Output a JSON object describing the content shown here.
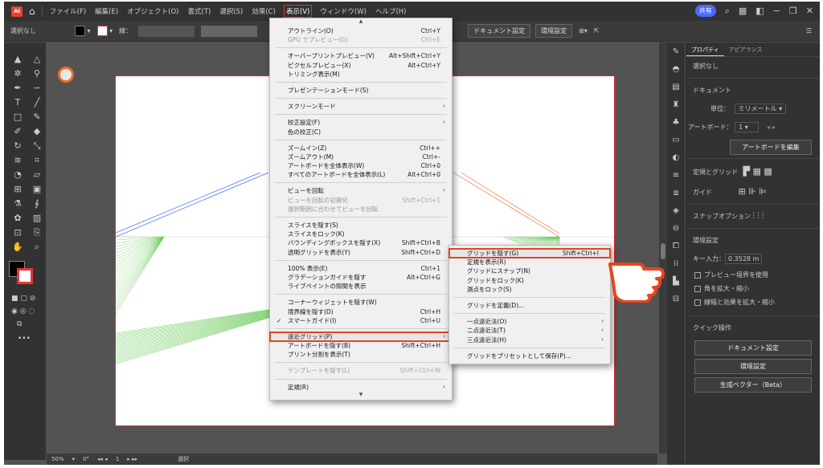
{
  "menubar": {
    "logo": "Ai",
    "items": [
      "ファイル(F)",
      "編集(E)",
      "オブジェクト(O)",
      "書式(T)",
      "選択(S)",
      "効果(C)",
      "表示(V)",
      "ウィンドウ(W)",
      "ヘルプ(H)"
    ],
    "active_index": 6,
    "share": "共有"
  },
  "control": {
    "selection": "選択なし",
    "stroke_label": "線：",
    "doc_settings": "ドキュメント設定",
    "preferences": "環境設定"
  },
  "view_menu": {
    "rows": [
      {
        "label": "アウトライン(O)",
        "shortcut": "Ctrl+Y"
      },
      {
        "label": "GPU でプレビュー(G)",
        "shortcut": "Ctrl+E",
        "disabled": true
      },
      {
        "sep": true
      },
      {
        "label": "オーバープリントプレビュー(V)",
        "shortcut": "Alt+Shift+Ctrl+Y"
      },
      {
        "label": "ピクセルプレビュー(X)",
        "shortcut": "Alt+Ctrl+Y"
      },
      {
        "label": "トリミング表示(M)",
        "shortcut": ""
      },
      {
        "sep": true
      },
      {
        "label": "プレゼンテーションモード(S)",
        "shortcut": ""
      },
      {
        "sep": true
      },
      {
        "label": "スクリーンモード",
        "shortcut": "",
        "sub": true
      },
      {
        "sep": true
      },
      {
        "label": "校正設定(F)",
        "shortcut": "",
        "sub": true
      },
      {
        "label": "色の校正(C)",
        "shortcut": ""
      },
      {
        "sep": true
      },
      {
        "label": "ズームイン(Z)",
        "shortcut": "Ctrl++"
      },
      {
        "label": "ズームアウト(M)",
        "shortcut": "Ctrl+-"
      },
      {
        "label": "アートボードを全体表示(W)",
        "shortcut": "Ctrl+0"
      },
      {
        "label": "すべてのアートボードを全体表示(L)",
        "shortcut": "Alt+Ctrl+0"
      },
      {
        "sep": true
      },
      {
        "label": "ビューを回転",
        "shortcut": "",
        "sub": true
      },
      {
        "label": "ビューを回転の初期化",
        "shortcut": "Shift+Ctrl+1",
        "disabled": true
      },
      {
        "label": "選択範囲に合わせてビューを回転",
        "shortcut": "",
        "disabled": true
      },
      {
        "sep": true
      },
      {
        "label": "スライスを隠す(S)",
        "shortcut": ""
      },
      {
        "label": "スライスをロック(K)",
        "shortcut": ""
      },
      {
        "label": "バウンディングボックスを隠す(X)",
        "shortcut": "Shift+Ctrl+B"
      },
      {
        "label": "透明グリッドを表示(Y)",
        "shortcut": "Shift+Ctrl+D"
      },
      {
        "sep": true
      },
      {
        "label": "100% 表示(E)",
        "shortcut": "Ctrl+1"
      },
      {
        "label": "グラデーションガイドを隠す",
        "shortcut": "Alt+Ctrl+G"
      },
      {
        "label": "ライブペイントの隙間を表示",
        "shortcut": ""
      },
      {
        "sep": true
      },
      {
        "label": "コーナーウィジェットを隠す(W)",
        "shortcut": ""
      },
      {
        "label": "境界線を隠す(D)",
        "shortcut": "Ctrl+H"
      },
      {
        "label": "スマートガイド(I)",
        "shortcut": "Ctrl+U",
        "checked": true
      },
      {
        "sep": true
      },
      {
        "label": "遠近グリッド(P)",
        "shortcut": "",
        "sub": true,
        "highlight": true
      },
      {
        "label": "アートボードを隠す(B)",
        "shortcut": "Shift+Ctrl+H"
      },
      {
        "label": "プリント分割を表示(T)",
        "shortcut": ""
      },
      {
        "sep": true
      },
      {
        "label": "テンプレートを隠す(L)",
        "shortcut": "Shift+Ctrl+W",
        "disabled": true
      },
      {
        "sep": true
      },
      {
        "label": "定規(R)",
        "shortcut": "",
        "sub": true
      }
    ]
  },
  "sub_menu": {
    "rows": [
      {
        "label": "グリッドを隠す(G)",
        "shortcut": "Shift+Ctrl+I",
        "highlight": true
      },
      {
        "label": "定規を表示(R)",
        "shortcut": ""
      },
      {
        "label": "グリッドにスナップ(N)",
        "shortcut": ""
      },
      {
        "label": "グリッドをロック(K)",
        "shortcut": ""
      },
      {
        "label": "測点をロック(S)",
        "shortcut": ""
      },
      {
        "sep": true
      },
      {
        "label": "グリッドを定義(D)...",
        "shortcut": ""
      },
      {
        "sep": true
      },
      {
        "label": "一点遠近法(O)",
        "shortcut": "",
        "sub": true
      },
      {
        "label": "二点遠近法(T)",
        "shortcut": "",
        "sub": true
      },
      {
        "label": "三点遠近法(H)",
        "shortcut": "",
        "sub": true
      },
      {
        "sep": true
      },
      {
        "label": "グリッドをプリセットとして保存(P)...",
        "shortcut": ""
      }
    ]
  },
  "panel": {
    "tabs": [
      "プロパティ",
      "アピアランス"
    ],
    "selection": "選択なし",
    "document": "ドキュメント",
    "unit_label": "単位：",
    "unit_value": "ミリメートル",
    "artboard_label": "アートボード：",
    "artboard_value": "1",
    "edit_artboard": "アートボードを編集",
    "rulers_grids": "定規とグリッド",
    "guides": "ガイド",
    "snap": "スナップオプション",
    "prefs": "環境設定",
    "key_input_label": "キー入力：",
    "key_input_value": "0.3528 m",
    "check1": "プレビュー境界を使用",
    "check2": "角を拡大・縮小",
    "check3": "線幅と効果を拡大・縮小",
    "quick": "クイック操作",
    "btn_doc": "ドキュメント設定",
    "btn_pref": "環境設定",
    "btn_gen": "生成ベクター（Beta）"
  },
  "status": {
    "zoom": "50%",
    "rotate": "0°",
    "artboard": "1",
    "tool": "選択"
  }
}
